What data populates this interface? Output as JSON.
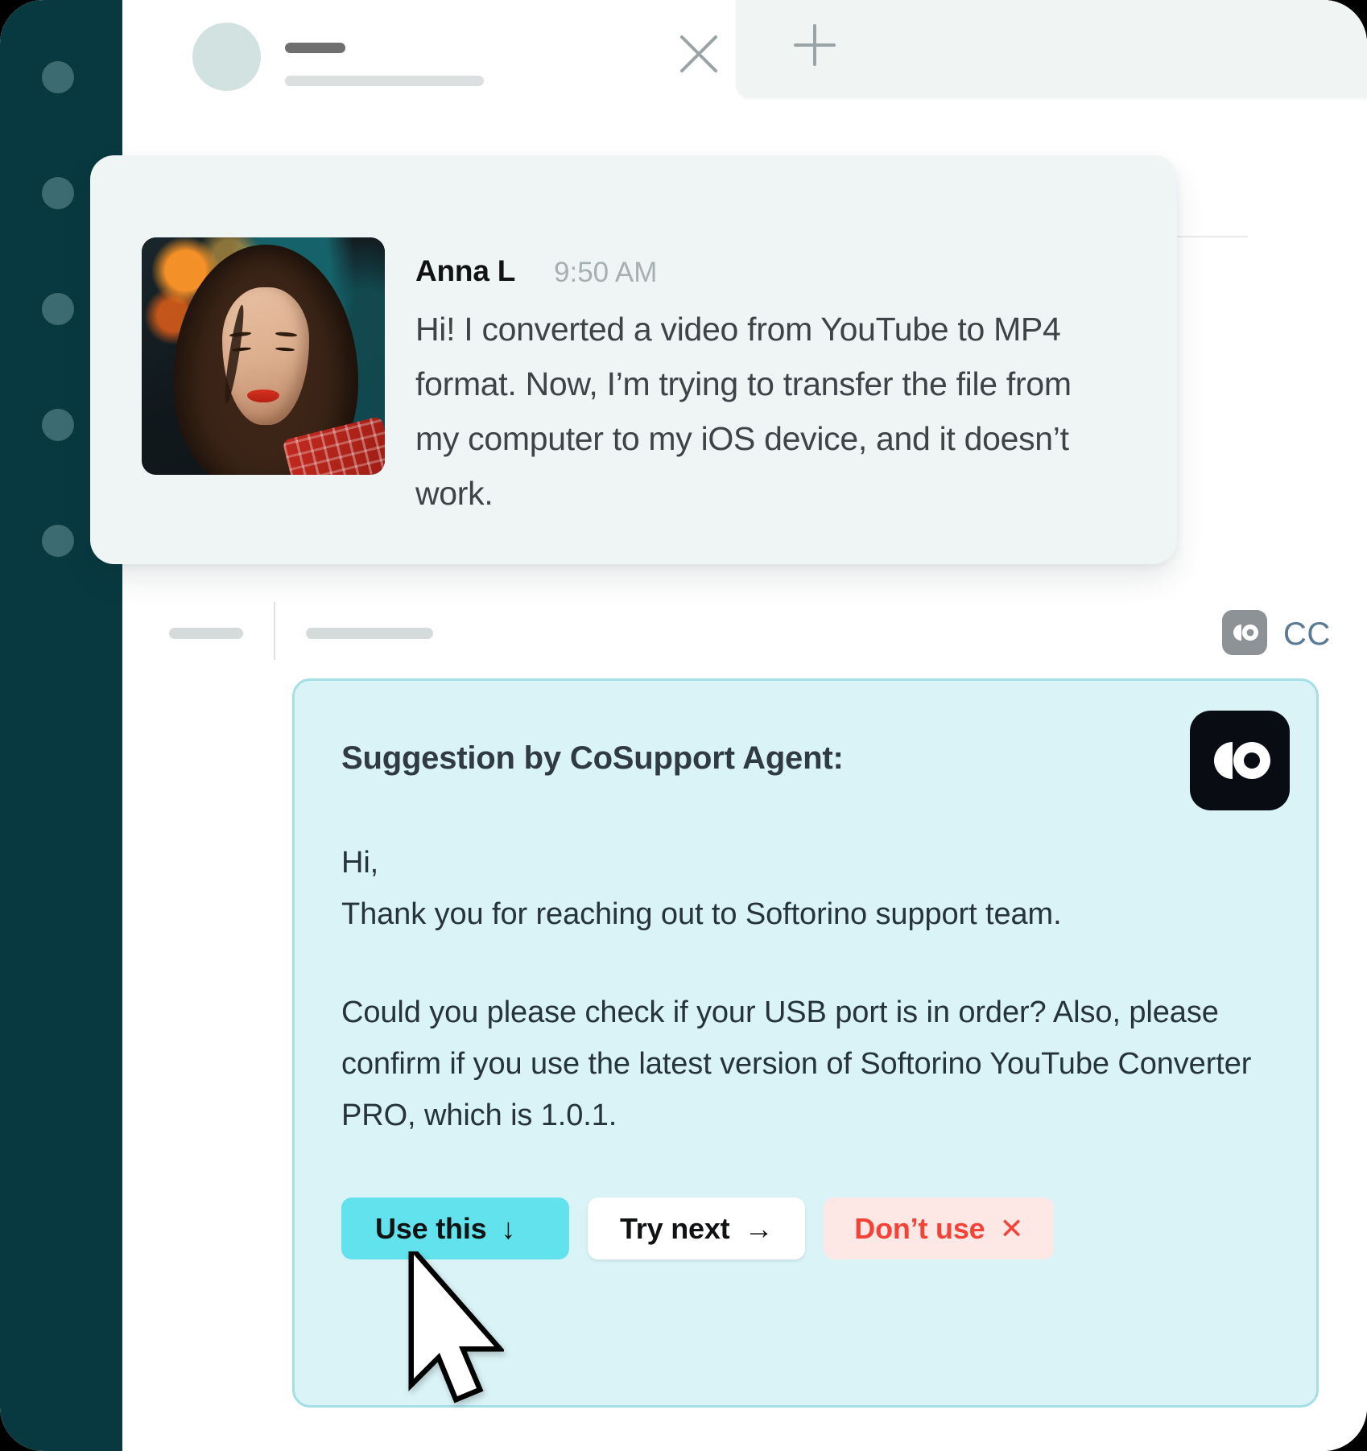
{
  "window": {
    "background_color": "#000000",
    "panel_color": "#ffffff"
  },
  "sidebar": {
    "background_color": "#083940",
    "dot_color": "#3d6b72",
    "items": [
      {
        "name": "sidebar-dot-1"
      },
      {
        "name": "sidebar-dot-2"
      },
      {
        "name": "sidebar-dot-3"
      },
      {
        "name": "sidebar-dot-4"
      },
      {
        "name": "sidebar-dot-5"
      }
    ]
  },
  "tabbar": {
    "active_tab": {
      "avatar_placeholder": "avatar-placeholder",
      "title_placeholder": "title-placeholder",
      "subtitle_placeholder": "subtitle-placeholder",
      "close_icon": "close-icon"
    },
    "new_tab": {
      "icon": "plus-icon",
      "background_color": "#f0f5f4"
    }
  },
  "message": {
    "author": "Anna L",
    "time": "9:50 AM",
    "text": "Hi! I converted a video from YouTube to MP4 format. Now, I’m trying to transfer the file from my computer to my iOS device, and it doesn’t work.",
    "avatar_alt": "avatar-photo",
    "card_color": "#eff4f4"
  },
  "meta_row": {
    "pill_a": "placeholder-pill",
    "pill_b": "placeholder-pill",
    "cc_icon": "cosupport-logo-icon",
    "cc_label": "CC",
    "cc_label_color": "#5b7a93",
    "cc_icon_color": "#8d9296"
  },
  "suggestion": {
    "title": "Suggestion by CoSupport Agent:",
    "logo_icon": "cosupport-logo-icon",
    "logo_color": "#0a0c14",
    "greeting": "Hi,",
    "greeting_line2": "Thank you for reaching out to Softorino support team.",
    "body": "Could you please check if your USB port is in order? Also, please confirm if you use the latest version of Softorino YouTube Converter PRO, which is 1.0.1.",
    "background_color": "#d9f3f7",
    "border_color": "#a5dee5",
    "buttons": [
      {
        "label": "Use this",
        "glyph": "↓",
        "icon_name": "arrow-down-icon",
        "background_color": "#61e2ec",
        "text_color": "#101214"
      },
      {
        "label": "Try next",
        "glyph": "→",
        "icon_name": "arrow-right-icon",
        "background_color": "#ffffff",
        "text_color": "#101214"
      },
      {
        "label": "Don’t use",
        "glyph": "✕",
        "icon_name": "close-x-icon",
        "background_color": "#fde8e6",
        "text_color": "#f44336"
      }
    ]
  },
  "cursor": {
    "icon": "mouse-pointer-icon"
  }
}
